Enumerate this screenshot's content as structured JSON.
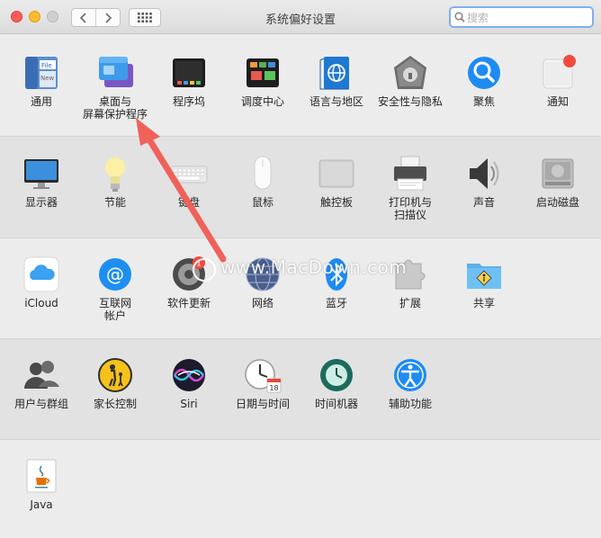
{
  "window": {
    "title": "系统偏好设置"
  },
  "search": {
    "placeholder": "搜索"
  },
  "watermark": "www.MacDown.com",
  "colors": {
    "accent": "#1e8bf3",
    "close": "#fc5b57",
    "minimize": "#fdbc2e",
    "arrow": "#f0615a"
  },
  "rows": [
    {
      "items": [
        {
          "label": "通用",
          "icon": "general-icon"
        },
        {
          "label": "桌面与\n屏幕保护程序",
          "icon": "desktop-screensaver-icon"
        },
        {
          "label": "程序坞",
          "icon": "dock-icon"
        },
        {
          "label": "调度中心",
          "icon": "mission-control-icon"
        },
        {
          "label": "语言与地区",
          "icon": "language-region-icon"
        },
        {
          "label": "安全性与隐私",
          "icon": "security-privacy-icon"
        },
        {
          "label": "聚焦",
          "icon": "spotlight-icon"
        },
        {
          "label": "通知",
          "icon": "notifications-icon"
        }
      ]
    },
    {
      "items": [
        {
          "label": "显示器",
          "icon": "display-icon"
        },
        {
          "label": "节能",
          "icon": "energy-saver-icon"
        },
        {
          "label": "键盘",
          "icon": "keyboard-icon"
        },
        {
          "label": "鼠标",
          "icon": "mouse-icon"
        },
        {
          "label": "触控板",
          "icon": "trackpad-icon"
        },
        {
          "label": "打印机与\n扫描仪",
          "icon": "printer-scanner-icon"
        },
        {
          "label": "声音",
          "icon": "sound-icon"
        },
        {
          "label": "启动磁盘",
          "icon": "startup-disk-icon"
        }
      ]
    },
    {
      "items": [
        {
          "label": "iCloud",
          "icon": "icloud-icon"
        },
        {
          "label": "互联网\n帐户",
          "icon": "internet-accounts-icon"
        },
        {
          "label": "软件更新",
          "icon": "software-update-icon",
          "badge": "1"
        },
        {
          "label": "网络",
          "icon": "network-icon"
        },
        {
          "label": "蓝牙",
          "icon": "bluetooth-icon"
        },
        {
          "label": "扩展",
          "icon": "extensions-icon"
        },
        {
          "label": "共享",
          "icon": "sharing-icon"
        }
      ]
    },
    {
      "items": [
        {
          "label": "用户与群组",
          "icon": "users-groups-icon"
        },
        {
          "label": "家长控制",
          "icon": "parental-controls-icon"
        },
        {
          "label": "Siri",
          "icon": "siri-icon"
        },
        {
          "label": "日期与时间",
          "icon": "date-time-icon",
          "calendar_day": "18"
        },
        {
          "label": "时间机器",
          "icon": "time-machine-icon"
        },
        {
          "label": "辅助功能",
          "icon": "accessibility-icon"
        }
      ]
    },
    {
      "items": [
        {
          "label": "Java",
          "icon": "java-icon"
        }
      ]
    }
  ]
}
